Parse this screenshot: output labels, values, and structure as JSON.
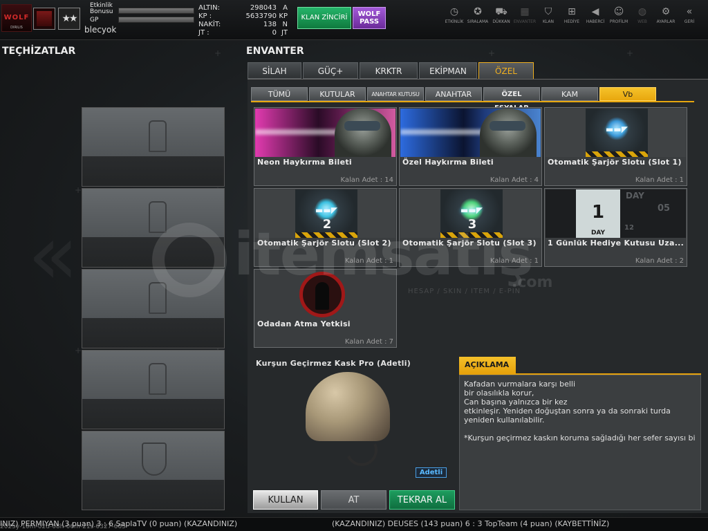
{
  "header": {
    "username": "blecyok",
    "event_bonus_label": "Etkinlik\nBonusu",
    "gp_label": "GP",
    "currencies": [
      {
        "label": "ALTIN:",
        "value": "298043",
        "unit": "A"
      },
      {
        "label": "KP  :",
        "value": "5633790",
        "unit": "KP"
      },
      {
        "label": "NAKİT:",
        "value": "138",
        "unit": "N"
      },
      {
        "label": "JT  :",
        "value": "0",
        "unit": "JT"
      }
    ],
    "clan_chain_label": "KLAN ZİNCİRİ",
    "wolf_pass_label": "WOLF\nPASS",
    "nav": [
      {
        "icon": "clock-icon",
        "label": "ETKİNLİK"
      },
      {
        "icon": "medal-icon",
        "label": "SIRALAMA"
      },
      {
        "icon": "cart-icon",
        "label": "DÜKKAN"
      },
      {
        "icon": "inventory-icon",
        "label": "ENVANTER"
      },
      {
        "icon": "shield-icon",
        "label": "KLAN"
      },
      {
        "icon": "gift-icon",
        "label": "HEDİYE"
      },
      {
        "icon": "megaphone-icon",
        "label": "HABERCİ"
      },
      {
        "icon": "profile-icon",
        "label": "PROFİLM"
      },
      {
        "icon": "globe-icon",
        "label": "WEB"
      },
      {
        "icon": "gear-icon",
        "label": "AYARLAR"
      },
      {
        "icon": "back-icon",
        "label": "GERİ"
      }
    ]
  },
  "equipment": {
    "title": "TEÇHİZATLAR"
  },
  "inventory": {
    "title": "ENVANTER",
    "main_tabs": [
      "SİLAH",
      "GÜÇ+",
      "KRKTR",
      "EKİPMAN",
      "ÖZEL"
    ],
    "active_main_tab": "ÖZEL",
    "sub_tabs": [
      "TÜMÜ",
      "KUTULAR",
      "ANAHTAR KUTUSU",
      "ANAHTAR",
      "ÖZEL EŞYALAR",
      "KAM",
      "Vb"
    ],
    "active_sub_tab": "Vb",
    "items": [
      {
        "name": "Neon Haykırma Bileti",
        "qty": "Kalan Adet : 14"
      },
      {
        "name": "Özel Haykırma Bileti",
        "qty": "Kalan Adet : 4"
      },
      {
        "name": "Otomatik Şarjör Slotu (Slot 1)",
        "qty": "Kalan Adet : 1"
      },
      {
        "name": "Otomatik Şarjör Slotu (Slot 2)",
        "qty": "Kalan Adet : 1"
      },
      {
        "name": "Otomatik Şarjör Slotu (Slot 3)",
        "qty": "Kalan Adet : 1"
      },
      {
        "name": "1 Günlük Hediye Kutusu Uza...",
        "qty": "Kalan Adet : 2"
      },
      {
        "name": "Odadan Atma Yetkisi",
        "qty": "Kalan Adet : 7"
      }
    ],
    "item_art_text": {
      "slot2_num": "2",
      "slot3_num": "3",
      "day_big": "1",
      "day_label": "DAY",
      "day_label_2": "DAY",
      "day_05": "05",
      "day_12": "12"
    }
  },
  "detail": {
    "title": "Kurşun Geçirmez Kask Pro (Adetli)",
    "badge": "Adetli",
    "description_header": "AÇIKLAMA",
    "description": "Kafadan vurmalara karşı belli\nbir olasılıkla korur,\nCan başına yalnızca bir kez\netkinleşir. Yeniden doğuştan sonra ya da sonraki turda\nyeniden kullanılabilir.\n\n*Kurşun geçirmez kaskın koruma sağladığı her sefer sayısı bi",
    "buttons": {
      "use": "KULLAN",
      "drop": "AT",
      "return": "TEKRAR AL"
    }
  },
  "ticker": {
    "left": "INIZ) PERMIYAN (3 puan) 3 : 6 SaplaTV (0 puan) (KAZANDINIZ)",
    "right": "(KAZANDINIZ) DEUSES (143 puan) 6 : 3 TopTeam (4 puan) (KAYBETTİNİZ)",
    "timestamp": "2025y-10m-02d-08h-06m-21s-0327-665"
  },
  "watermark": {
    "brand": "itemsatış",
    "domain": ".com",
    "tagline": "HESAP / SKIN / ITEM / E-PIN"
  },
  "colors": {
    "accent": "#f0b020",
    "green": "#1d9c5e",
    "purple": "#8e44c4"
  }
}
